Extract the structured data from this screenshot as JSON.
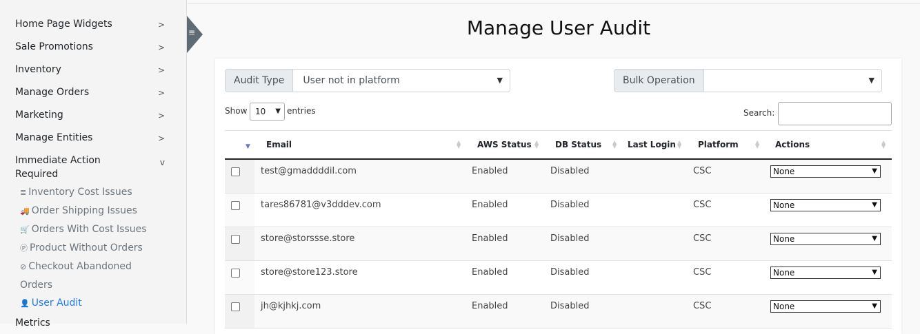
{
  "sidebar": {
    "items": [
      {
        "label": "Home Page Widgets"
      },
      {
        "label": "Sale Promotions"
      },
      {
        "label": "Inventory"
      },
      {
        "label": "Manage Orders"
      },
      {
        "label": "Marketing"
      },
      {
        "label": "Manage Entities"
      },
      {
        "label": "Immediate Action Required"
      }
    ],
    "sub_items": [
      {
        "label": "Inventory Cost Issues",
        "icon": "≣"
      },
      {
        "label": "Order Shipping Issues",
        "icon": "🚚"
      },
      {
        "label": "Orders With Cost Issues",
        "icon": "🛒"
      },
      {
        "label": "Product Without Orders",
        "icon": "Ⓟ"
      },
      {
        "label": "Checkout Abandoned Orders",
        "icon": "⊘"
      },
      {
        "label": "User Audit",
        "icon": "👤"
      }
    ],
    "next_item": "Metrics"
  },
  "page": {
    "title": "Manage User Audit"
  },
  "filters": {
    "audit_type_label": "Audit Type",
    "audit_type_value": "User not in platform",
    "bulk_label": "Bulk Operation",
    "bulk_value": ""
  },
  "table_controls": {
    "show": "Show",
    "length": "10",
    "entries": "entries",
    "search_label": "Search:"
  },
  "table": {
    "columns": [
      "Email",
      "AWS Status",
      "DB Status",
      "Last Login",
      "Platform",
      "Actions"
    ],
    "rows": [
      {
        "email": "test@gmaddddil.com",
        "aws": "Enabled",
        "db": "Disabled",
        "last_login": "",
        "platform": "CSC",
        "action": "None"
      },
      {
        "email": "tares86781@v3dddev.com",
        "aws": "Enabled",
        "db": "Disabled",
        "last_login": "",
        "platform": "CSC",
        "action": "None"
      },
      {
        "email": "store@storssse.store",
        "aws": "Enabled",
        "db": "Disabled",
        "last_login": "",
        "platform": "CSC",
        "action": "None"
      },
      {
        "email": "store@store123.store",
        "aws": "Enabled",
        "db": "Disabled",
        "last_login": "",
        "platform": "CSC",
        "action": "None"
      },
      {
        "email": "jh@kjhkj.com",
        "aws": "Enabled",
        "db": "Disabled",
        "last_login": "",
        "platform": "CSC",
        "action": "None"
      }
    ]
  },
  "colors": {
    "accent": "#1e7cf2",
    "toggle": "#5f6b74"
  }
}
